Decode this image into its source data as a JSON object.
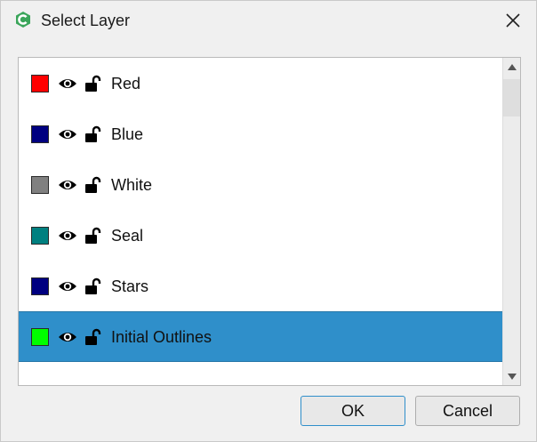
{
  "window": {
    "title": "Select Layer",
    "app_icon": "app-logo-icon",
    "close_icon": "close-icon"
  },
  "layers": [
    {
      "name": "Red",
      "color": "#ff0000",
      "visible": true,
      "locked": false
    },
    {
      "name": "Blue",
      "color": "#000080",
      "visible": true,
      "locked": false
    },
    {
      "name": "White",
      "color": "#808080",
      "visible": true,
      "locked": false
    },
    {
      "name": "Seal",
      "color": "#008080",
      "visible": true,
      "locked": false
    },
    {
      "name": "Stars",
      "color": "#000080",
      "visible": true,
      "locked": false
    },
    {
      "name": "Initial Outlines",
      "color": "#00ff00",
      "visible": true,
      "locked": false,
      "selected": true
    }
  ],
  "buttons": {
    "ok_label": "OK",
    "cancel_label": "Cancel"
  },
  "colors": {
    "selection": "#2f8fca",
    "accent": "#2f8fca"
  }
}
